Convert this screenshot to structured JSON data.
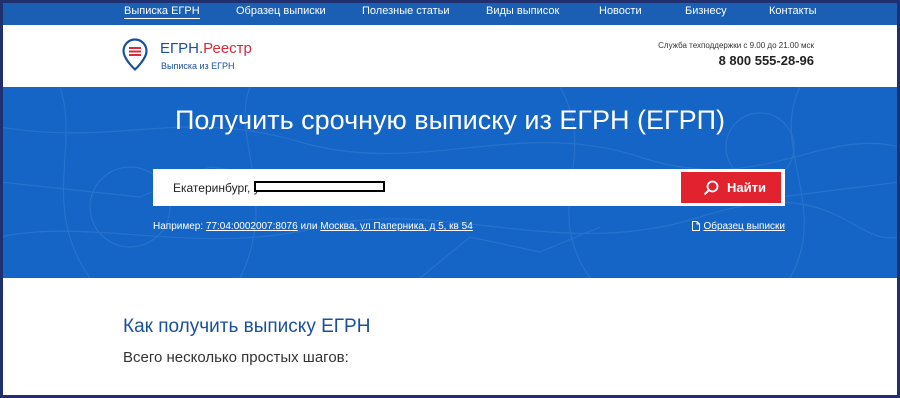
{
  "nav": {
    "items": [
      {
        "label": "Выписка ЕГРН",
        "active": true
      },
      {
        "label": "Образец выписки",
        "active": false
      },
      {
        "label": "Полезные статьи",
        "active": false
      },
      {
        "label": "Виды выписок",
        "active": false
      },
      {
        "label": "Новости",
        "active": false
      },
      {
        "label": "Бизнесу",
        "active": false
      },
      {
        "label": "Контакты",
        "active": false
      }
    ]
  },
  "header": {
    "logo_main": "ЕГРН",
    "logo_dot": ".",
    "logo_accent": "Реестр",
    "logo_sub": "Выписка из ЕГРН",
    "support_text": "Служба техподдержки с 9.00 до 21.00 мск",
    "phone": "8 800 555-28-96"
  },
  "hero": {
    "title": "Получить срочную выписку из ЕГРН (ЕГРП)",
    "search_value": "Екатеринбург, ул.",
    "search_button": "Найти",
    "example_prefix": "Например:",
    "example_cadastral": "77:04:0002007:8076",
    "example_or": "или",
    "example_address": "Москва, ул Паперника, д 5, кв 54",
    "sample_link": "Образец выписки"
  },
  "content": {
    "title": "Как получить выписку ЕГРН",
    "subtitle": "Всего несколько простых шагов:"
  },
  "colors": {
    "nav_bg": "#1a5fb4",
    "hero_bg": "#1565c6",
    "brand_blue": "#1a4f9c",
    "brand_red": "#e0232f"
  }
}
